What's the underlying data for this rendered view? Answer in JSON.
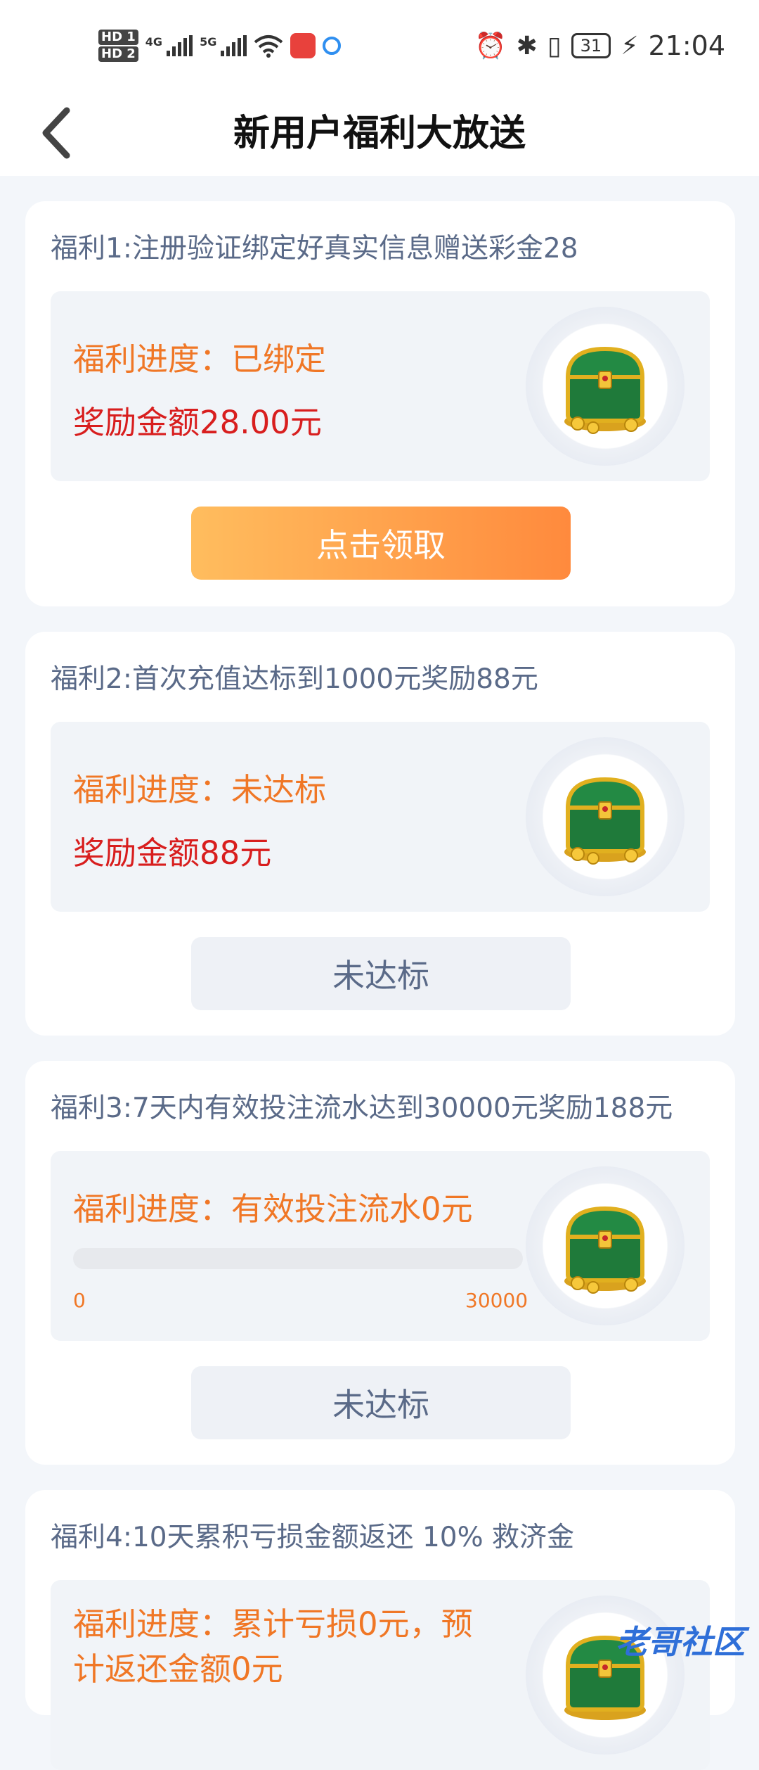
{
  "status_bar": {
    "time": "21:04",
    "battery": "31",
    "hd1": "HD 1",
    "hd2": "HD 2",
    "net1": "4G",
    "net2": "5G"
  },
  "header": {
    "title": "新用户福利大放送"
  },
  "cards": [
    {
      "title": "福利1:注册验证绑定好真实信息赠送彩金28",
      "progress": "福利进度：已绑定",
      "amount": "奖励金额28.00元",
      "button": "点击领取"
    },
    {
      "title": "福利2:首次充值达标到1000元奖励88元",
      "progress": "福利进度：未达标",
      "amount": "奖励金额88元",
      "button": "未达标"
    },
    {
      "title": "福利3:7天内有效投注流水达到30000元奖励188元",
      "progress": "福利进度：有效投注流水0元",
      "progress_value": 0,
      "range_min": "0",
      "range_max": "30000",
      "button": "未达标"
    },
    {
      "title": "福利4:10天累积亏损金额返还 10% 救济金",
      "progress_line1": "福利进度：累计亏损0元，预",
      "progress_line2": "计返还金额0元"
    }
  ],
  "watermark": "老哥社区",
  "colors": {
    "accent_orange": "#f07726",
    "amount_red": "#d81e1e",
    "claim_gradient": [
      "#ffbd5e",
      "#ff8a3d"
    ],
    "title_gray_blue": "#5a6a88"
  }
}
